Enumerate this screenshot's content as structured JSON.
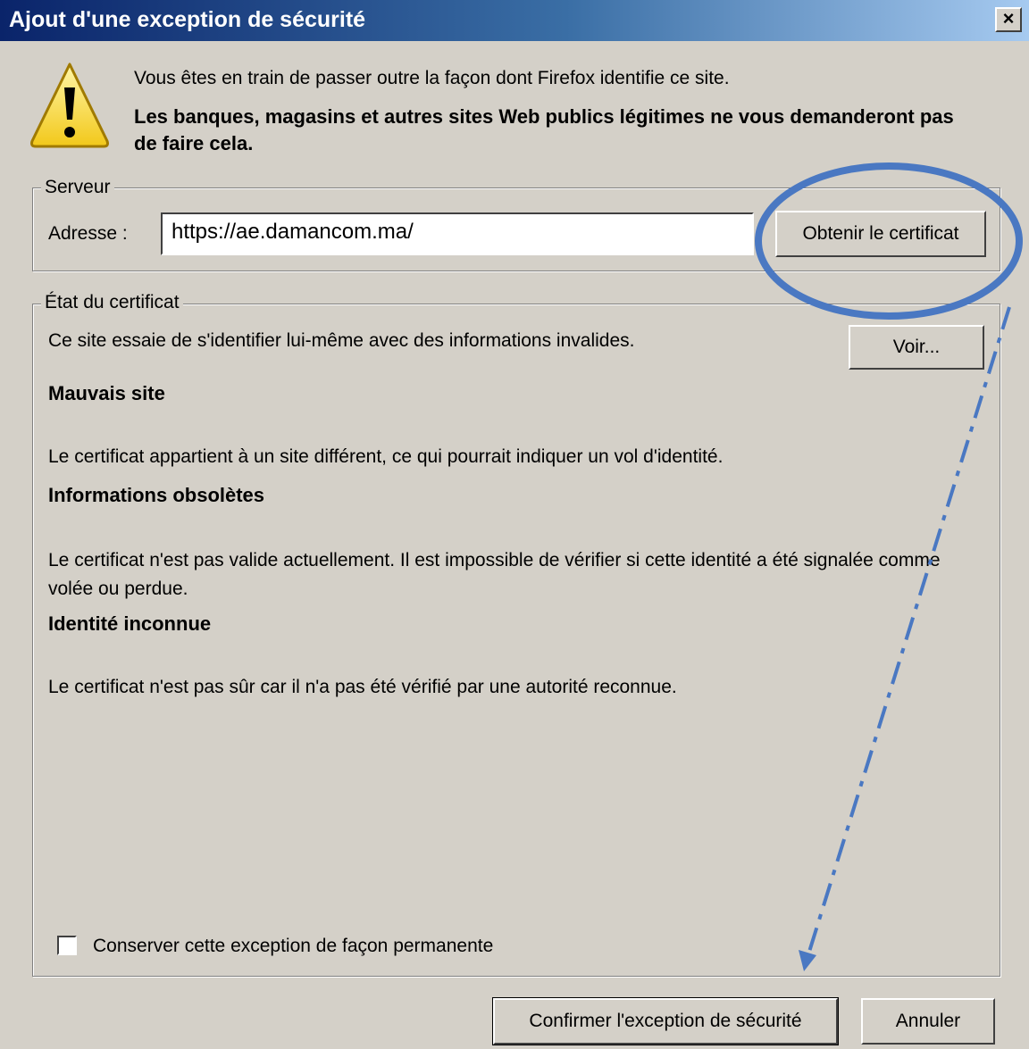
{
  "window": {
    "title": "Ajout d'une exception de sécurité",
    "close_label": "×"
  },
  "warning": {
    "line1": "Vous êtes en train de passer outre la façon dont Firefox identifie ce site.",
    "line2": "Les banques, magasins et autres sites Web publics légitimes ne vous demanderont pas de faire cela."
  },
  "server": {
    "legend": "Serveur",
    "address_label": "Adresse :",
    "address_value": "https://ae.damancom.ma/",
    "get_certificate_label": "Obtenir le certificat"
  },
  "certificate_status": {
    "legend": "État du certificat",
    "summary": "Ce site essaie de s'identifier lui-même avec des informations invalides.",
    "view_label": "Voir...",
    "issues": [
      {
        "title": "Mauvais site",
        "description": "Le certificat appartient à un site différent, ce qui pourrait indiquer un vol d'identité."
      },
      {
        "title": "Informations obsolètes",
        "description": "Le certificat n'est pas valide actuellement. Il est impossible de vérifier si cette identité a été signalée comme volée ou perdue."
      },
      {
        "title": "Identité inconnue",
        "description": "Le certificat n'est pas sûr car il n'a pas été vérifié par une autorité reconnue."
      }
    ],
    "permanent_checkbox_label": "Conserver cette exception de façon permanente",
    "permanent_checked": false
  },
  "footer": {
    "confirm_label": "Confirmer l'exception de sécurité",
    "cancel_label": "Annuler"
  },
  "annotation": {
    "color": "#4a78c2"
  }
}
